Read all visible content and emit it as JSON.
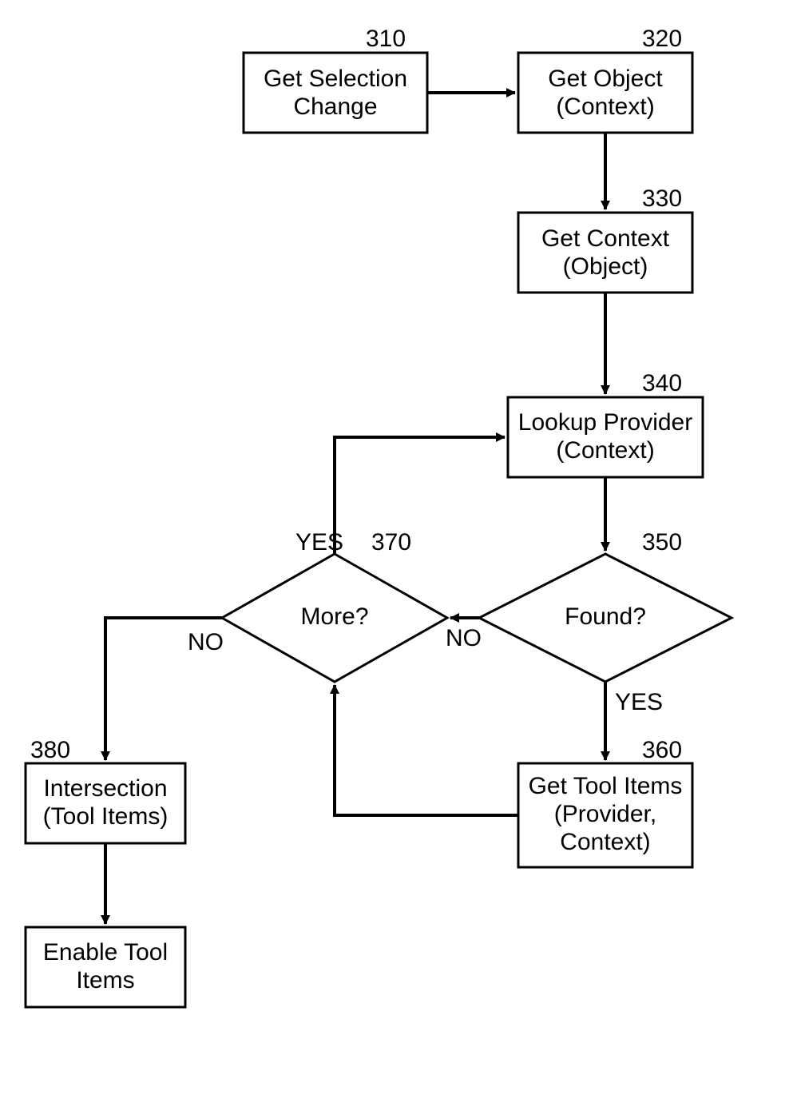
{
  "nodes": {
    "n310": {
      "num": "310",
      "line1": "Get Selection",
      "line2": "Change"
    },
    "n320": {
      "num": "320",
      "line1": "Get Object",
      "line2": "(Context)"
    },
    "n330": {
      "num": "330",
      "line1": "Get Context",
      "line2": "(Object)"
    },
    "n340": {
      "num": "340",
      "line1": "Lookup Provider",
      "line2": "(Context)"
    },
    "n350": {
      "num": "350",
      "line1": "Found?"
    },
    "n360": {
      "num": "360",
      "line1": "Get Tool Items",
      "line2": "(Provider,",
      "line3": "Context)"
    },
    "n370": {
      "num": "370",
      "line1": "More?"
    },
    "n380": {
      "num": "380",
      "line1": "Intersection",
      "line2": "(Tool Items)"
    },
    "n390": {
      "line1": "Enable Tool",
      "line2": "Items"
    }
  },
  "edges": {
    "yes": "YES",
    "no": "NO"
  }
}
